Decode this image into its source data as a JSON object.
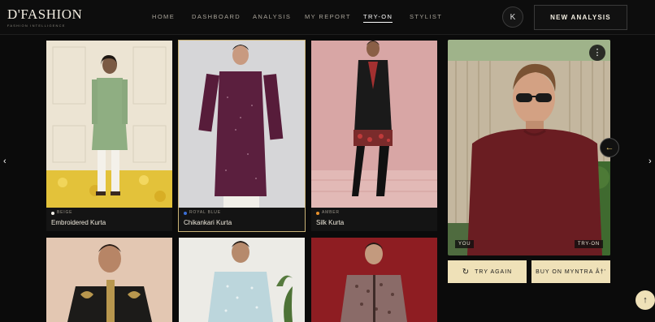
{
  "brand": {
    "name": "D'FASHION",
    "tagline": "FASHION INTELLIGENCE"
  },
  "nav": {
    "items": [
      {
        "label": "HOME",
        "active": false
      },
      {
        "label": "DASHBOARD",
        "active": false
      },
      {
        "label": "ANALYSIS",
        "active": false
      },
      {
        "label": "MY REPORT",
        "active": false
      },
      {
        "label": "TRY-ON",
        "active": true
      },
      {
        "label": "STYLIST",
        "active": false
      }
    ],
    "avatar_initial": "K",
    "new_analysis_label": "NEW ANALYSIS"
  },
  "carousel": {
    "prev_icon": "chevron-left-icon",
    "next_icon": "chevron-right-icon"
  },
  "products": [
    {
      "name": "Embroidered Kurta",
      "color": "BEIGE",
      "dot": "#f2efe8",
      "selected": false
    },
    {
      "name": "Chikankari Kurta",
      "color": "ROYAL BLUE",
      "dot": "#3b6fd6",
      "selected": true
    },
    {
      "name": "Silk Kurta",
      "color": "AMBER",
      "dot": "#e8912c",
      "selected": false
    },
    {
      "name": "",
      "color": "",
      "dot": "",
      "selected": false
    },
    {
      "name": "",
      "color": "",
      "dot": "",
      "selected": false
    },
    {
      "name": "",
      "color": "",
      "dot": "",
      "selected": false
    }
  ],
  "tryon": {
    "you_label": "YOU",
    "tryon_label": "TRY-ON",
    "more_icon": "more-vertical-icon",
    "compare_icon": "arrow-left-icon",
    "try_again_label": "TRY AGAIN",
    "buy_label": "BUY ON MYNTRA Â†'"
  },
  "colors": {
    "accent": "#efe1b8",
    "gold": "#c9a44c",
    "background": "#0b0b0b"
  }
}
